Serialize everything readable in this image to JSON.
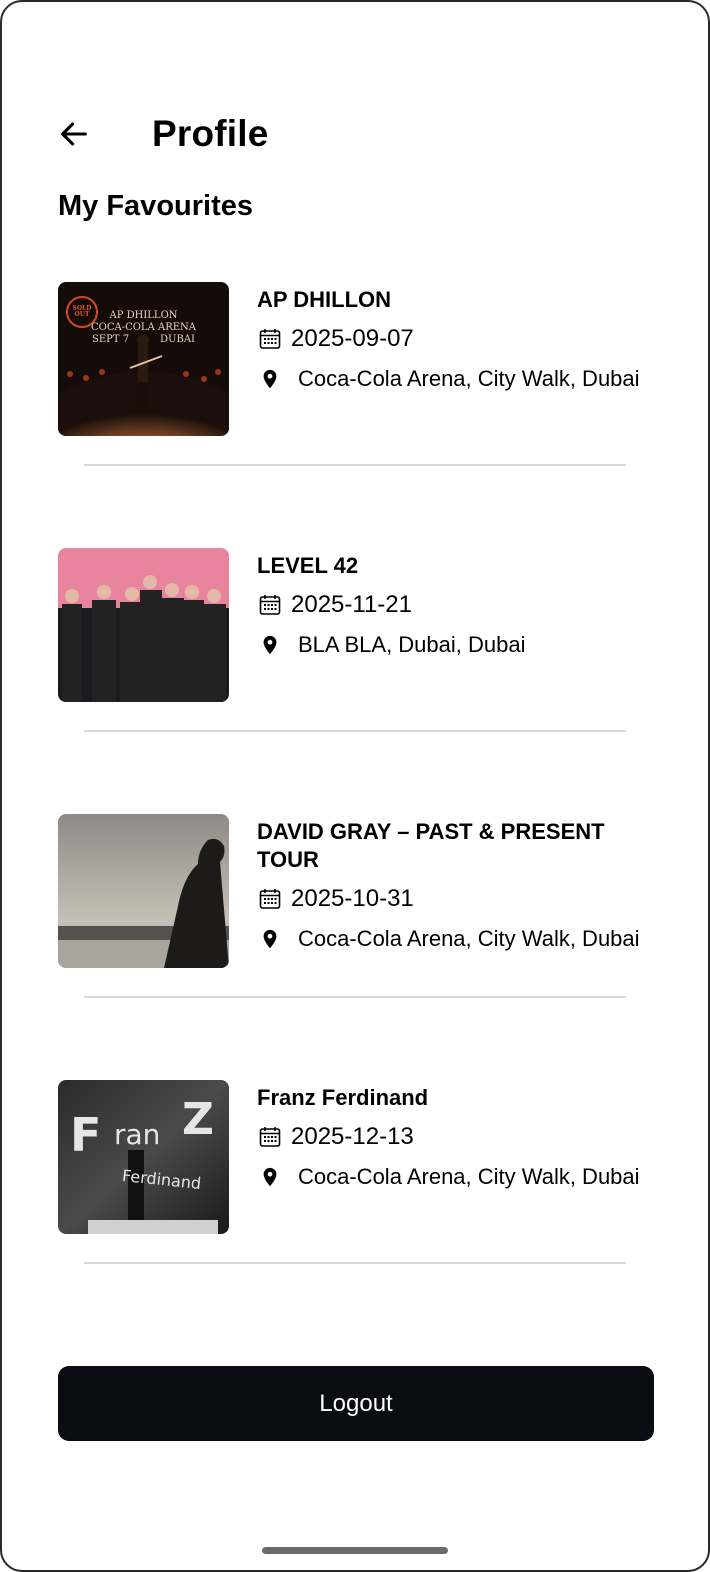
{
  "header": {
    "title": "Profile",
    "back_icon": "arrow-left-icon"
  },
  "section": {
    "title": "My Favourites"
  },
  "favourites": [
    {
      "title": "AP DHILLON",
      "date": "2025-09-07",
      "location": "Coca-Cola Arena, City Walk, Dubai",
      "poster_text": [
        "AP DHILLON",
        "COCA-COLA ARENA",
        "SEPT 7",
        "DUBAI"
      ],
      "badge": "SOLD OUT"
    },
    {
      "title": "LEVEL 42",
      "date": "2025-11-21",
      "location": "BLA BLA, Dubai, Dubai"
    },
    {
      "title": "DAVID GRAY – PAST & PRESENT TOUR",
      "date": "2025-10-31",
      "location": "Coca-Cola Arena, City Walk, Dubai"
    },
    {
      "title": "Franz Ferdinand",
      "date": "2025-12-13",
      "location": "Coca-Cola Arena, City Walk, Dubai",
      "poster_text": [
        "F",
        "ran",
        "Z",
        "Ferdinand"
      ]
    }
  ],
  "logout": {
    "label": "Logout"
  },
  "icons": {
    "date": "calendar-icon",
    "location": "map-pin-icon"
  },
  "colors": {
    "button_bg": "#0b0b14",
    "divider": "#d6d6d6"
  }
}
